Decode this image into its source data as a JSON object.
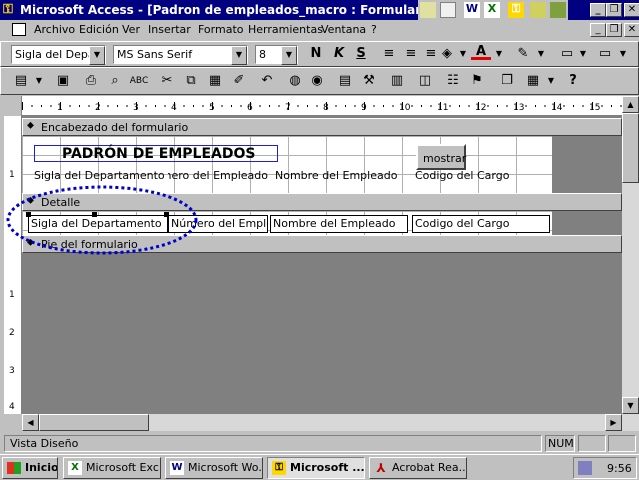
{
  "window": {
    "title": "Microsoft Access - [Padron de empleados_macro : Formulario]",
    "minimize": "_",
    "restore": "❐",
    "close": "✕"
  },
  "menu": [
    "Archivo",
    "Edición",
    "Ver",
    "Insertar",
    "Formato",
    "Herramientas",
    "Ventana",
    "?"
  ],
  "formatting_toolbar": {
    "object_combo": "Sigla del Depart",
    "font_combo": "MS Sans Serif",
    "size_combo": "8",
    "bold": "N",
    "italic": "K",
    "underline": "S"
  },
  "ruler_numbers": [
    "1",
    "2",
    "3",
    "4",
    "5",
    "6",
    "7",
    "8",
    "9",
    "10",
    "11",
    "12",
    "13",
    "14",
    "15"
  ],
  "form": {
    "header_section": "Encabezado del formulario",
    "title_label": "PADRÓN DE EMPLEADOS",
    "show_button": "mostrar",
    "header_labels": [
      "Sigla del Departamento",
      "Número del Empleado",
      "Nombre del Empleado",
      "Codigo del Cargo"
    ],
    "detail_section": "Detalle",
    "detail_fields": [
      "Sigla del Departamento",
      "Número del Emplead",
      "Nombre del Empleado",
      "Codigo del Cargo"
    ],
    "footer_section": "Pie del formulario"
  },
  "vertical_ruler": [
    "1",
    "1",
    "2",
    "3",
    "4"
  ],
  "status": {
    "text": "Vista Diseño",
    "num": "NUM"
  },
  "taskbar": {
    "start": "Inicio",
    "buttons": [
      "Microsoft Exc...",
      "Microsoft Wo...",
      "Microsoft ...",
      "Acrobat Rea..."
    ],
    "clock": "9:56"
  },
  "colors": {
    "title_bg": "#000080",
    "desktop_gray": "#c0c0c0",
    "dark_canvas": "#808080",
    "annotation_circle": "#0000cc"
  }
}
